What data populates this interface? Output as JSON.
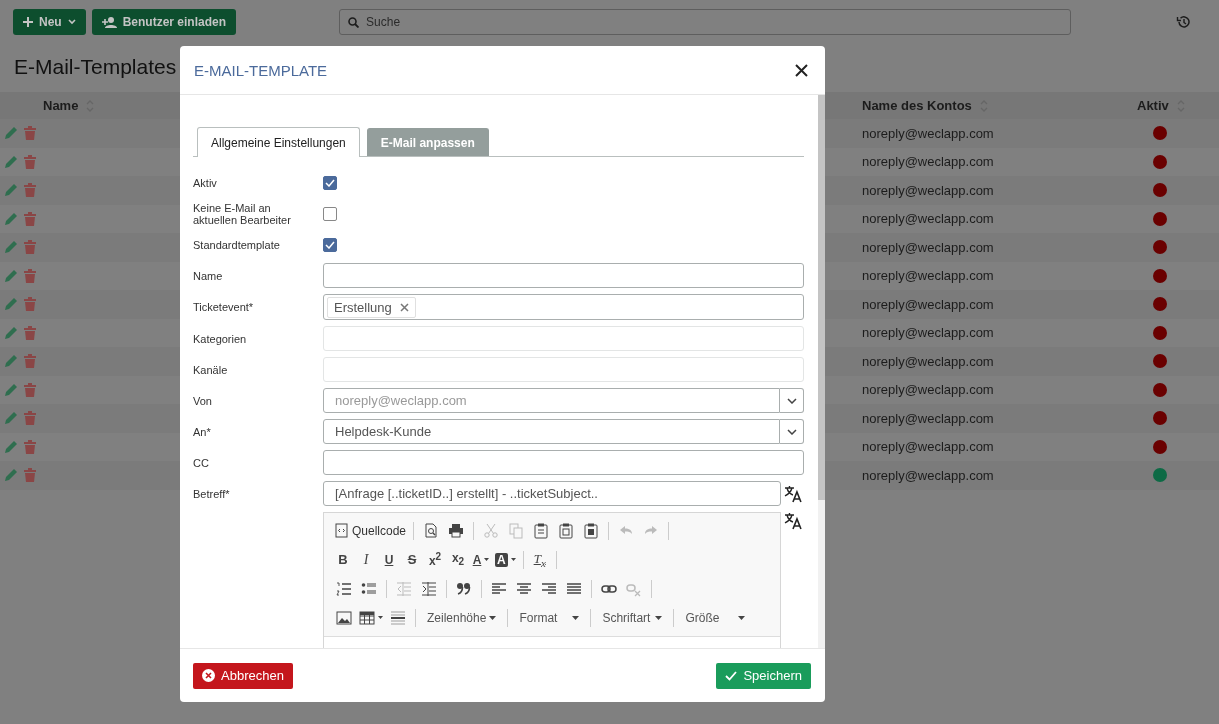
{
  "topbar": {
    "new_button": "Neu",
    "invite_button": "Benutzer einladen",
    "search": {
      "placeholder": "Suche"
    }
  },
  "page_title": "E-Mail-Templates",
  "table": {
    "columns": [
      "Name",
      "Name des Kontos",
      "Aktiv"
    ],
    "rows": [
      {
        "account": "noreply@weclapp.com",
        "color": "#6a0000"
      },
      {
        "account": "noreply@weclapp.com",
        "color": "#6a0000"
      },
      {
        "account": "noreply@weclapp.com",
        "color": "#6a0000"
      },
      {
        "account": "noreply@weclapp.com",
        "color": "#6a0000"
      },
      {
        "account": "noreply@weclapp.com",
        "color": "#6a0000"
      },
      {
        "account": "noreply@weclapp.com",
        "color": "#6a0000"
      },
      {
        "account": "noreply@weclapp.com",
        "color": "#6a0000"
      },
      {
        "account": "noreply@weclapp.com",
        "color": "#6a0000"
      },
      {
        "account": "noreply@weclapp.com",
        "color": "#6a0000"
      },
      {
        "account": "noreply@weclapp.com",
        "color": "#6a0000"
      },
      {
        "account": "noreply@weclapp.com",
        "color": "#6a0000"
      },
      {
        "account": "noreply@weclapp.com",
        "color": "#6a0000"
      },
      {
        "account": "noreply@weclapp.com",
        "color": "#0d6a45"
      }
    ]
  },
  "dialog": {
    "title": "E-MAIL-TEMPLATE",
    "tabs": [
      {
        "label": "Allgemeine Einstellungen",
        "selected": true
      },
      {
        "label": "E-Mail anpassen",
        "selected": false
      }
    ],
    "fields": [
      {
        "kind": "checkbox",
        "label": "Aktiv",
        "checked": true
      },
      {
        "kind": "checkbox",
        "label": "Keine E-Mail an aktuellen Bearbeiter",
        "checked": false
      },
      {
        "kind": "checkbox",
        "label": "Standardtemplate",
        "checked": true
      },
      {
        "kind": "text",
        "label": "Name",
        "disabled": false
      },
      {
        "kind": "tags",
        "label": "Ticketevent*",
        "tags": [
          "Erstellung"
        ]
      },
      {
        "kind": "text",
        "label": "Kategorien",
        "disabled": true
      },
      {
        "kind": "text",
        "label": "Kanäle",
        "disabled": true
      },
      {
        "kind": "select",
        "label": "Von",
        "placeholder": "noreply@weclapp.com"
      },
      {
        "kind": "select",
        "label": "An*",
        "value": "Helpdesk-Kunde"
      },
      {
        "kind": "text",
        "label": "CC",
        "disabled": false
      },
      {
        "kind": "translatable",
        "label": "Betreff*",
        "value": "[Anfrage [..ticketID..] erstellt] - ..ticketSubject.."
      }
    ],
    "editor": {
      "toolbars": [
        {
          "items": [
            {
              "kind": "source",
              "label": "Quellcode",
              "disabled": false
            },
            {
              "kind": "separator"
            },
            {
              "kind": "preview",
              "disabled": false
            },
            {
              "kind": "print",
              "disabled": false
            },
            {
              "kind": "separator"
            },
            {
              "kind": "cut",
              "disabled": true
            },
            {
              "kind": "copy",
              "disabled": true
            },
            {
              "kind": "paste",
              "disabled": false
            },
            {
              "kind": "paste-text",
              "disabled": false
            },
            {
              "kind": "paste-word",
              "disabled": false
            },
            {
              "kind": "separator"
            },
            {
              "kind": "undo",
              "disabled": true
            },
            {
              "kind": "redo",
              "disabled": true
            },
            {
              "kind": "separator"
            }
          ]
        },
        {
          "items": [
            {
              "kind": "bold",
              "label": "B",
              "disabled": false
            },
            {
              "kind": "italic",
              "label": "I",
              "disabled": false
            },
            {
              "kind": "underline",
              "label": "U",
              "disabled": false
            },
            {
              "kind": "strike",
              "label": "S",
              "disabled": false
            },
            {
              "kind": "script",
              "label": "x$^{2}$",
              "disabled": false
            },
            {
              "kind": "script",
              "label": "x$_{2}$",
              "disabled": false
            },
            {
              "kind": "text-color",
              "label": "A",
              "disabled": false
            },
            {
              "kind": "background-color",
              "label": "A",
              "disabled": false
            },
            {
              "kind": "separator"
            },
            {
              "kind": "remove-format",
              "label": "T$_{x}$",
              "disabled": false
            },
            {
              "kind": "separator"
            }
          ]
        },
        {
          "items": [
            {
              "kind": "numbered-list",
              "disabled": false
            },
            {
              "kind": "bullet-list",
              "disabled": false
            },
            {
              "kind": "separator"
            },
            {
              "kind": "outdent",
              "disabled": true
            },
            {
              "kind": "indent",
              "disabled": false
            },
            {
              "kind": "separator"
            },
            {
              "kind": "blockquote",
              "disabled": false
            },
            {
              "kind": "separator"
            },
            {
              "kind": "align-left",
              "disabled": false
            },
            {
              "kind": "align-center",
              "disabled": false
            },
            {
              "kind": "align-right",
              "disabled": false
            },
            {
              "kind": "justify",
              "disabled": false
            },
            {
              "kind": "separator"
            },
            {
              "kind": "link",
              "disabled": false
            },
            {
              "kind": "unlink",
              "disabled": true
            },
            {
              "kind": "separator"
            }
          ]
        },
        {
          "items": [
            {
              "kind": "image",
              "disabled": false
            },
            {
              "kind": "table",
              "disabled": false
            },
            {
              "kind": "horizontal-line",
              "disabled": false
            },
            {
              "kind": "separator"
            },
            {
              "kind": "combo",
              "label": "Zeilenhöhe",
              "disabled": false
            },
            {
              "kind": "separator"
            },
            {
              "kind": "combo",
              "label": "Format",
              "disabled": false
            },
            {
              "kind": "separator"
            },
            {
              "kind": "combo",
              "label": "Schriftart",
              "disabled": false
            },
            {
              "kind": "separator"
            },
            {
              "kind": "combo",
              "label": "Größe",
              "disabled": false
            }
          ]
        }
      ]
    },
    "buttons": {
      "cancel": "Abbrechen",
      "save": "Speichern"
    }
  }
}
